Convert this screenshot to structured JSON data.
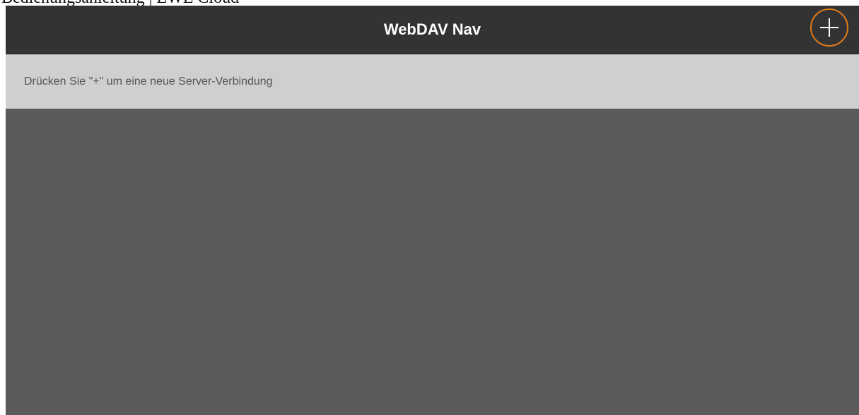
{
  "document": {
    "caption": "Bedienungsanleitung | EWE Cloud"
  },
  "navbar": {
    "title": "WebDAV Nav",
    "add_icon": "plus-icon",
    "accent_color": "#e07b1a",
    "background_color": "#333333"
  },
  "hint": {
    "text": "Drücken Sie \"+\" um eine neue Server-Verbindung"
  }
}
